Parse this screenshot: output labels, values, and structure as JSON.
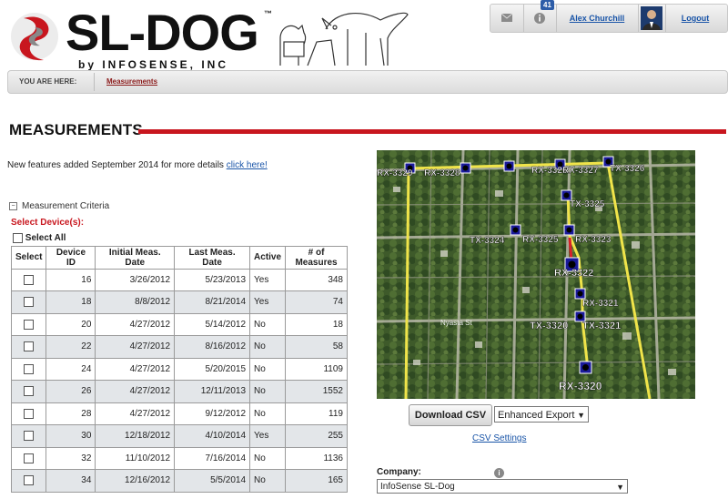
{
  "brand": {
    "name": "SL-DOG",
    "tm": "™",
    "tagline": "by INFOSENSE, INC"
  },
  "userbar": {
    "mail_icon": "envelope-icon",
    "info_icon": "info-icon",
    "notification_count": "41",
    "user_name": "Alex Churchill",
    "logout_label": "Logout"
  },
  "breadcrumb": {
    "label": "YOU ARE HERE:",
    "current": "Measurements"
  },
  "page": {
    "title": "MEASUREMENTS",
    "features_text": "New features added September 2014 for more details ",
    "features_link": "click here!"
  },
  "criteria": {
    "toggle": "−",
    "heading": "Measurement Criteria",
    "select_devices": "Select Device(s):",
    "select_all": "Select All"
  },
  "table": {
    "headers": [
      "Select",
      "Device ID",
      "Initial Meas. Date",
      "Last Meas. Date",
      "Active",
      "# of Measures"
    ],
    "rows": [
      [
        "16",
        "3/26/2012",
        "5/23/2013",
        "Yes",
        "348"
      ],
      [
        "18",
        "8/8/2012",
        "8/21/2014",
        "Yes",
        "74"
      ],
      [
        "20",
        "4/27/2012",
        "5/14/2012",
        "No",
        "18"
      ],
      [
        "22",
        "4/27/2012",
        "8/16/2012",
        "No",
        "58"
      ],
      [
        "24",
        "4/27/2012",
        "5/20/2015",
        "No",
        "1109"
      ],
      [
        "26",
        "4/27/2012",
        "12/11/2013",
        "No",
        "1552"
      ],
      [
        "28",
        "4/27/2012",
        "9/12/2012",
        "No",
        "119"
      ],
      [
        "30",
        "12/18/2012",
        "4/10/2014",
        "Yes",
        "255"
      ],
      [
        "32",
        "11/10/2012",
        "7/16/2014",
        "No",
        "1136"
      ],
      [
        "34",
        "12/16/2012",
        "5/5/2014",
        "No",
        "165"
      ]
    ]
  },
  "map": {
    "markers": [
      "RX-3329",
      "RX-3328",
      "RX-3326",
      "RX-3327",
      "TX-3326",
      "TX-3325",
      "TX-3324",
      "RX-3325",
      "RX-3323",
      "RX-3322",
      "RX-3321",
      "TX-3320",
      "TX-3321",
      "RX-3320"
    ],
    "street_label": "Nyasta St"
  },
  "export": {
    "download_label": "Download CSV",
    "export_option": "Enhanced Export",
    "csv_settings": "CSV Settings"
  },
  "company": {
    "label": "Company:",
    "value": "InfoSense SL-Dog"
  },
  "colors": {
    "accent_red": "#c8161e",
    "link_blue": "#1a55a8",
    "row_alt": "#e3e6e9"
  }
}
